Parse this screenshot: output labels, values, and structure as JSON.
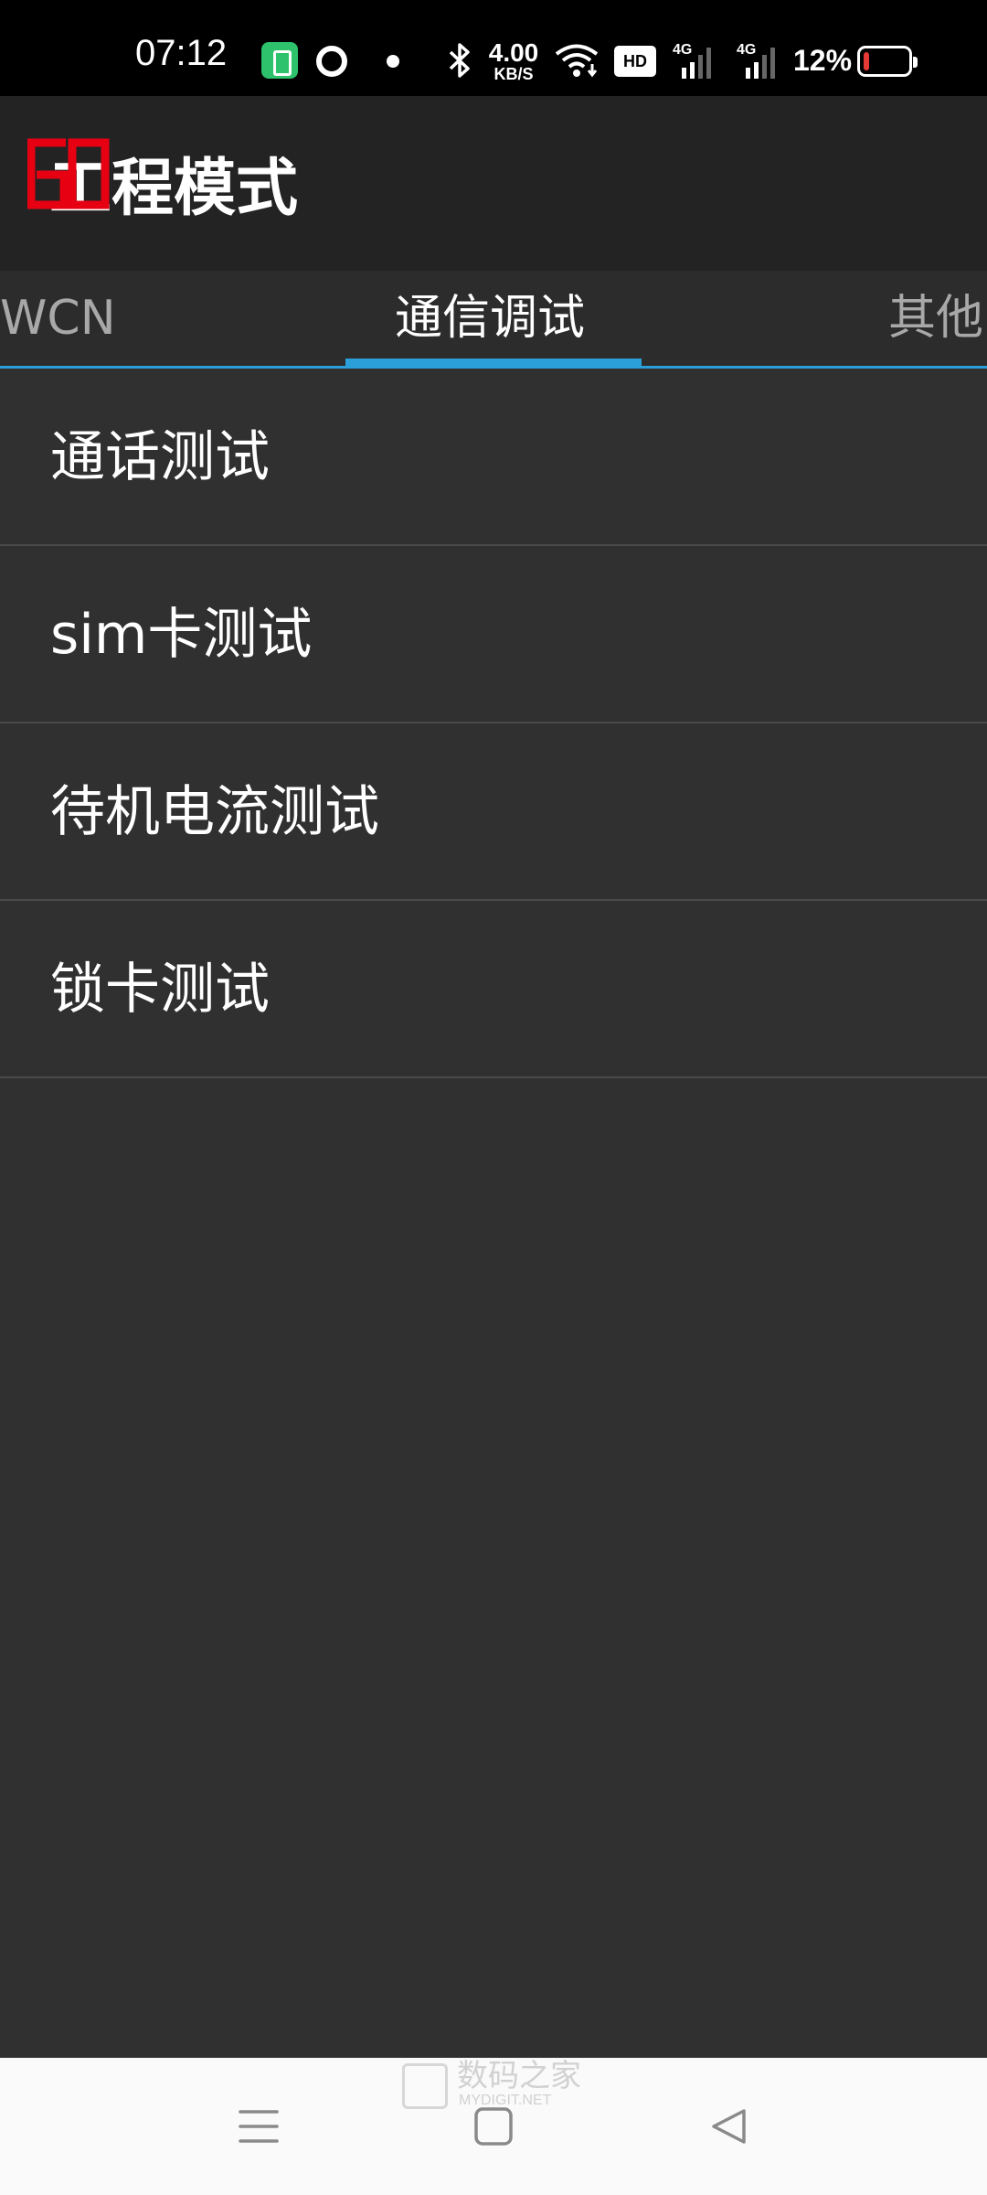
{
  "status_bar": {
    "time": "07:12",
    "net_speed_value": "4.00",
    "net_speed_unit": "KB/S",
    "hd_label": "HD",
    "sim1_label": "4G",
    "sim2_label": "4G",
    "battery_percent": "12%",
    "battery_level": 0.12
  },
  "app_bar": {
    "title": "工程模式",
    "logo_color": "#e60012"
  },
  "tabs": [
    {
      "label": "WCN",
      "selected": false
    },
    {
      "label": "通信调试",
      "selected": true
    },
    {
      "label": "其他",
      "selected": false
    }
  ],
  "list": {
    "items": [
      {
        "label": "通话测试"
      },
      {
        "label": "sim卡测试"
      },
      {
        "label": "待机电流测试"
      },
      {
        "label": "锁卡测试"
      }
    ]
  },
  "watermark": {
    "text": "数码之家",
    "subtext": "MYDIGIT.NET"
  },
  "nav_bar": {
    "menu_icon": "menu-icon",
    "home_icon": "home-icon",
    "back_icon": "back-icon"
  },
  "colors": {
    "accent": "#2a9fd8",
    "background": "#303030",
    "app_bar": "#232323"
  }
}
